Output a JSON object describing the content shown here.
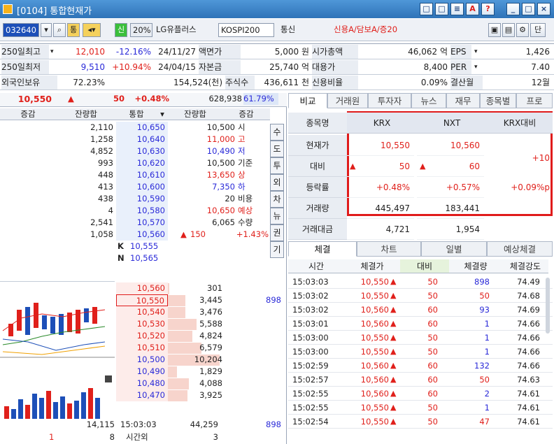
{
  "window": {
    "title": "[0104] 통합현재가",
    "btns": [
      "□",
      "□",
      "≡",
      "A",
      "?",
      "_",
      "□",
      "×"
    ]
  },
  "toolbar": {
    "code": "032640",
    "sel1": "통",
    "sel2": "신",
    "pct": "20%",
    "name": "LG유플러스",
    "market": "KOSPI200",
    "sector": "통신",
    "credit": "신용A/담보A/증20",
    "last_btn": "단"
  },
  "info": {
    "r1": [
      "250일최고",
      "12,010",
      "-12.16%",
      "24/11/27",
      "액면가",
      "5,000 원",
      "시가총액",
      "46,062 억",
      "EPS",
      "1,426"
    ],
    "r2": [
      "250일최저",
      "9,510",
      "+10.94%",
      "24/04/15",
      "자본금",
      "25,740 억",
      "대용가",
      "8,400",
      "PER",
      "7.40"
    ],
    "r3": [
      "외국인보유",
      "72.23%",
      "154,524(천)",
      "주식수",
      "436,611 천",
      "신용비율",
      "0.09%",
      "결산월",
      "12월"
    ]
  },
  "ob": {
    "price": "10,550",
    "diff": "50",
    "rate": "+0.48%",
    "vol": "628,938",
    "volpct": "61.79%",
    "h": [
      "증감",
      "잔량합",
      "통합",
      "잔량합",
      "증감"
    ],
    "sells": [
      [
        "2,110",
        "10,650"
      ],
      [
        "1,258",
        "10,640"
      ],
      [
        "4,852",
        "10,630"
      ],
      [
        "993",
        "10,620"
      ],
      [
        "448",
        "10,610"
      ],
      [
        "413",
        "10,600"
      ],
      [
        "438",
        "10,590"
      ],
      [
        "4",
        "10,580"
      ],
      [
        "2,541",
        "10,570"
      ],
      [
        "1,058",
        "10,560"
      ]
    ],
    "right_info": [
      [
        "10,500",
        "시"
      ],
      [
        "11,000",
        "고"
      ],
      [
        "10,490",
        "저"
      ],
      [
        "10,500",
        "기준"
      ],
      [
        "13,650",
        "상"
      ],
      [
        "7,350",
        "하"
      ],
      [
        "20",
        "비용"
      ],
      [
        "10,650",
        "예상"
      ],
      [
        "6,065",
        "수량"
      ]
    ],
    "exp_diff": "150",
    "exp_rate": "+1.43%",
    "side_tabs": [
      "수",
      "도",
      "투",
      "외",
      "차",
      "뉴",
      "권",
      "기"
    ],
    "kn": [
      [
        "K",
        "10,555"
      ],
      [
        "N",
        "10,565"
      ]
    ],
    "buys": [
      [
        "10,560",
        "301"
      ],
      [
        "10,550",
        "3,445"
      ],
      [
        "10,540",
        "3,476"
      ],
      [
        "10,530",
        "5,588"
      ],
      [
        "10,520",
        "4,824"
      ],
      [
        "10,510",
        "6,579"
      ],
      [
        "10,500",
        "10,204"
      ],
      [
        "10,490",
        "1,829"
      ],
      [
        "10,480",
        "4,088"
      ],
      [
        "10,470",
        "3,925"
      ]
    ],
    "buy_mark": "898",
    "foot": {
      "sell_total": "14,115",
      "time": "15:03:03",
      "buy_total": "44,259",
      "net": "898",
      "a": "1",
      "b": "8",
      "after": "시간외",
      "c": "3"
    }
  },
  "rp": {
    "tabs": [
      "비교",
      "거래원",
      "투자자",
      "뉴스",
      "재무",
      "종목별",
      "프로"
    ],
    "cmp_head": [
      "종목명",
      "KRX",
      "NXT",
      "KRX대비"
    ],
    "cmp_rows": [
      [
        "현재가",
        "10,550",
        "10,560",
        ""
      ],
      [
        "대비",
        "50",
        "60",
        "+10"
      ],
      [
        "등락률",
        "+0.48%",
        "+0.57%",
        "+0.09%p"
      ],
      [
        "거래량",
        "445,497",
        "183,441",
        ""
      ],
      [
        "거래대금",
        "4,721",
        "1,954",
        ""
      ]
    ],
    "tabs2": [
      "체결",
      "차트",
      "일별",
      "예상체결"
    ],
    "th": [
      "시간",
      "체결가",
      "대비",
      "체결량",
      "체결강도"
    ],
    "trades": [
      [
        "15:03:03",
        "10,550",
        "50",
        "898",
        "74.49"
      ],
      [
        "15:03:02",
        "10,550",
        "50",
        "50",
        "74.68"
      ],
      [
        "15:03:02",
        "10,560",
        "60",
        "93",
        "74.69"
      ],
      [
        "15:03:01",
        "10,560",
        "60",
        "1",
        "74.66"
      ],
      [
        "15:03:00",
        "10,550",
        "50",
        "1",
        "74.66"
      ],
      [
        "15:03:00",
        "10,550",
        "50",
        "1",
        "74.66"
      ],
      [
        "15:02:59",
        "10,560",
        "60",
        "132",
        "74.66"
      ],
      [
        "15:02:57",
        "10,560",
        "60",
        "50",
        "74.63"
      ],
      [
        "15:02:55",
        "10,560",
        "60",
        "2",
        "74.61"
      ],
      [
        "15:02:55",
        "10,550",
        "50",
        "1",
        "74.61"
      ],
      [
        "15:02:54",
        "10,550",
        "50",
        "47",
        "74.61"
      ]
    ]
  }
}
